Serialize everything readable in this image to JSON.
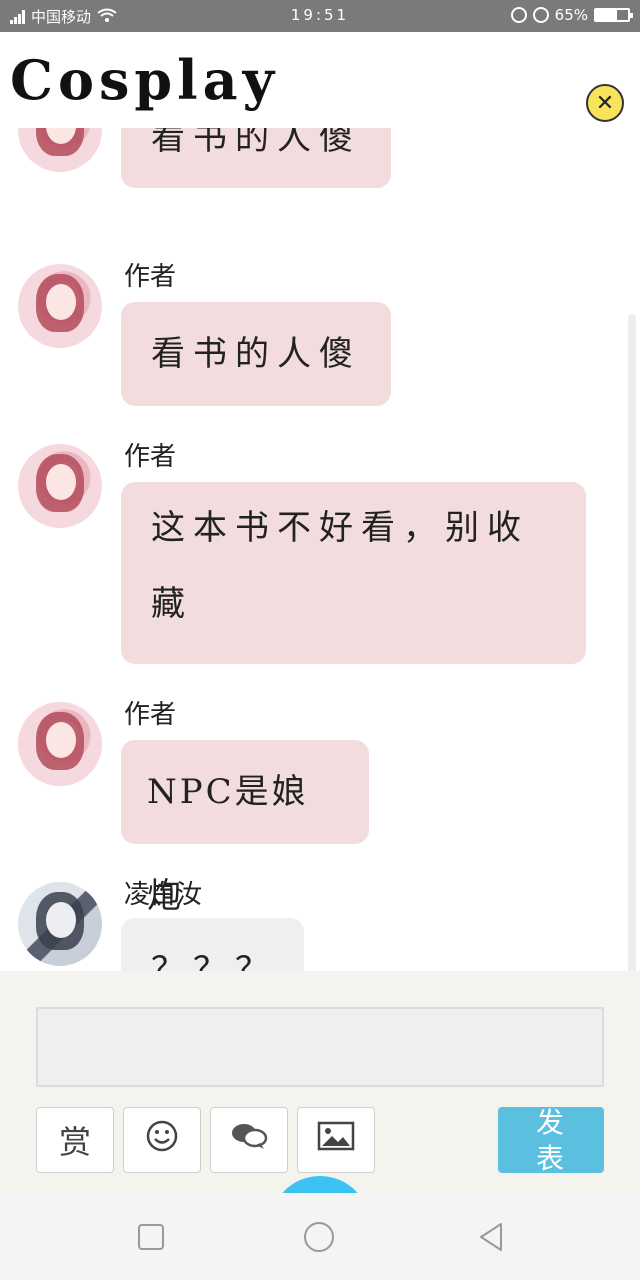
{
  "status_bar": {
    "carrier": "中国移动",
    "time": "19:51",
    "battery": "65%",
    "battery_level": 0.65
  },
  "header": {
    "title": "Cosplay",
    "close_icon": "close-x-icon"
  },
  "messages": [
    {
      "sender": "",
      "text": "看书的人傻"
    },
    {
      "sender": "作者",
      "text": "看书的人傻"
    },
    {
      "sender": "作者",
      "text": "这本书不好看，别收藏"
    },
    {
      "sender": "作者",
      "text": "NPC是娘炮"
    },
    {
      "sender": "凌白汝",
      "text": "？？？"
    }
  ],
  "composer": {
    "input_value": "",
    "tools": [
      {
        "label": "赏",
        "icon": "reward-icon"
      },
      {
        "label": "",
        "icon": "emoji-icon"
      },
      {
        "label": "",
        "icon": "chat-bubbles-icon"
      },
      {
        "label": "",
        "icon": "image-icon"
      }
    ],
    "send_label": "发表"
  },
  "nav": {
    "icons": [
      "square-recent-icon",
      "circle-home-icon",
      "triangle-back-icon"
    ]
  },
  "colors": {
    "bubble": "#f2dcdd",
    "bubble_other": "#efefef",
    "send_button": "#5bbfe0",
    "close_button": "#f7e45a"
  }
}
